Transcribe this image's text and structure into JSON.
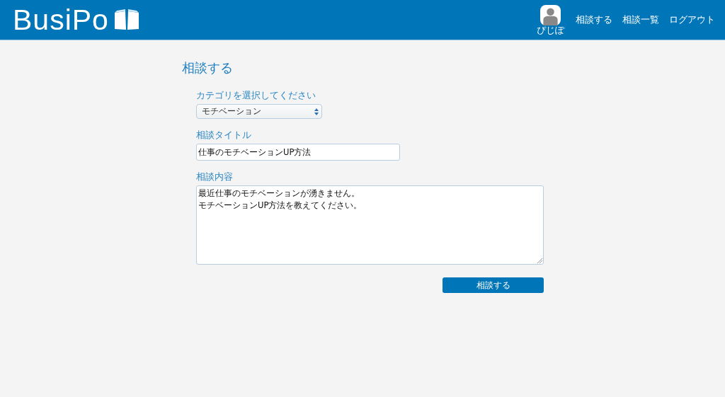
{
  "header": {
    "logo": "BusiPo",
    "user": {
      "name": "ぴじぽ"
    },
    "nav": [
      "相談する",
      "相談一覧",
      "ログアウト"
    ]
  },
  "page_title": "相談する",
  "form": {
    "category": {
      "label": "カテゴリを選択してください",
      "value": "モチベーション"
    },
    "title": {
      "label": "相談タイトル",
      "value": "仕事のモチベーションUP方法"
    },
    "content": {
      "label": "相談内容",
      "lines": [
        "最近仕事のモチベーションが湧きません。",
        "モチベーションUP方法を教えてください。"
      ]
    },
    "submit": "相談する"
  }
}
